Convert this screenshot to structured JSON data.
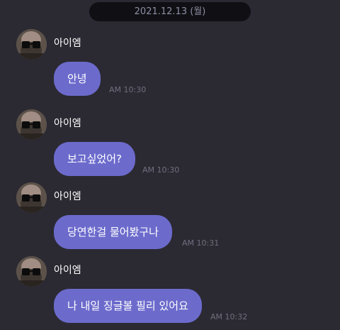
{
  "chat": {
    "date": "2021.12.13 (월)",
    "messages": [
      {
        "sender": "아이엠",
        "avatar": "profile-photo",
        "text": "안녕",
        "time": "AM 10:30"
      },
      {
        "sender": "아이엠",
        "avatar": "profile-photo",
        "text": "보고싶었어?",
        "time": "AM 10:30"
      },
      {
        "sender": "아이엠",
        "avatar": "profile-photo",
        "text": "당연한걸 물어봤구나",
        "time": "AM 10:31"
      },
      {
        "sender": "아이엠",
        "avatar": "profile-photo",
        "text": "나 내일 징글볼 필리 있어요",
        "time": "AM 10:32"
      }
    ]
  },
  "colors": {
    "background": "#2b2a33",
    "bubble": "#6c6bcc",
    "date_pill": "#0f0f14",
    "timestamp": "#6f6e7d"
  }
}
